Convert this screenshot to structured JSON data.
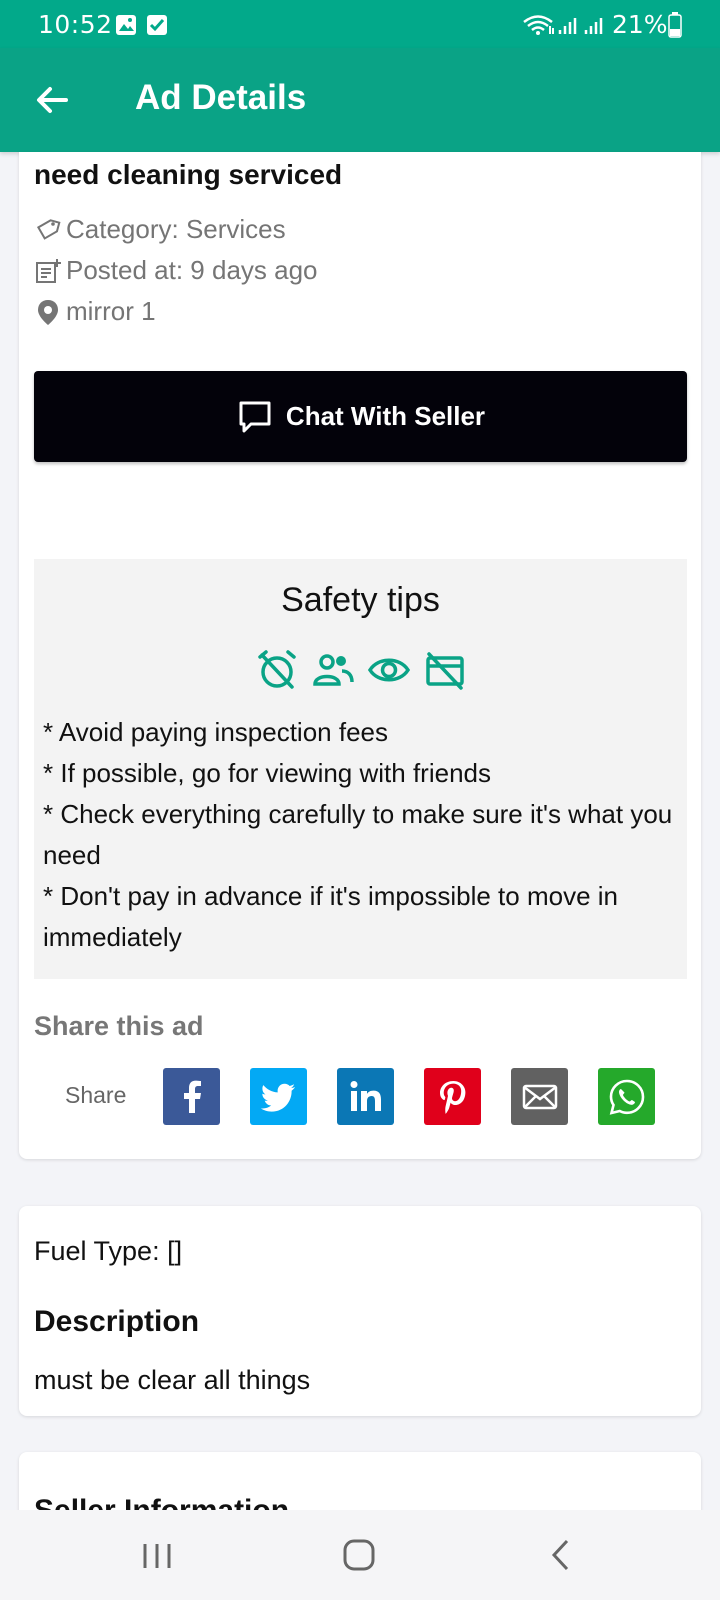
{
  "status_bar": {
    "time": "10:52",
    "battery": "21%"
  },
  "app_bar": {
    "title": "Ad Details"
  },
  "ad": {
    "title": "need cleaning serviced",
    "category": "Category: Services",
    "posted": "Posted at: 9 days ago",
    "location": "mirror 1"
  },
  "chat_button": {
    "label": "Chat With Seller"
  },
  "safety": {
    "title": "Safety tips",
    "tips": [
      "* Avoid paying inspection fees",
      "* If possible, go for viewing with friends",
      "* Check everything carefully to make sure it's what you need",
      "* Don't pay in advance if it's impossible to move in immediately"
    ]
  },
  "share": {
    "heading": "Share this ad",
    "label": "Share",
    "buttons": [
      {
        "name": "facebook",
        "color": "#3b5998"
      },
      {
        "name": "twitter",
        "color": "#03a9f4"
      },
      {
        "name": "linkedin",
        "color": "#0b77b5"
      },
      {
        "name": "pinterest",
        "color": "#e0001b"
      },
      {
        "name": "email",
        "color": "#616161"
      },
      {
        "name": "whatsapp",
        "color": "#25a92b"
      }
    ]
  },
  "details": {
    "fuel_type": "Fuel Type: []",
    "description_heading": "Description",
    "description": "must be clear all things"
  },
  "seller": {
    "heading": "Seller Information"
  },
  "colors": {
    "primary": "#0aa386",
    "status_bar": "#02a98a",
    "button_dark": "#03020a"
  }
}
